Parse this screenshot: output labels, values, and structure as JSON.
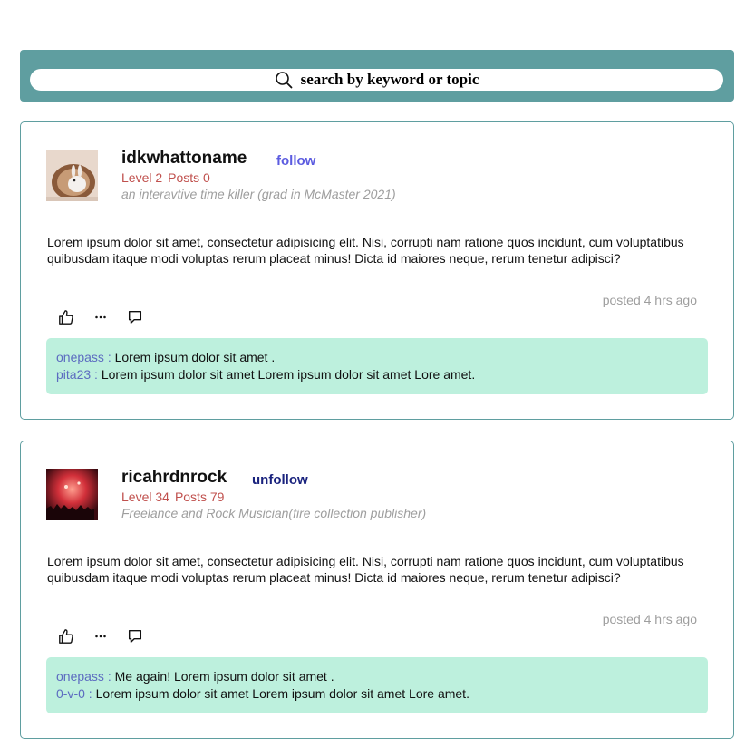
{
  "search": {
    "placeholder": "search by keyword or topic"
  },
  "posts": [
    {
      "username": "idkwhattoname",
      "follow_label": "follow",
      "follow_color": "#5c5ce0",
      "level": "Level 2",
      "posts": "Posts 0",
      "bio": "an interavtive time killer (grad in McMaster 2021)",
      "body": "Lorem ipsum dolor sit amet, consectetur adipisicing elit. Nisi, corrupti nam ratione quos incidunt, cum voluptatibus quibusdam itaque modi voluptas rerum placeat minus! Dicta id maiores neque, rerum tenetur adipisci?",
      "posted": "posted 4 hrs ago",
      "comments": [
        {
          "user": "onepass :",
          "text": " Lorem ipsum dolor sit amet ."
        },
        {
          "user": "pita23 :",
          "text": " Lorem ipsum dolor sit amet Lorem ipsum dolor sit amet Lore amet."
        }
      ]
    },
    {
      "username": "ricahrdnrock",
      "follow_label": "unfollow",
      "follow_color": "#1a237e",
      "level": "Level 34",
      "posts": "Posts 79",
      "bio": "Freelance and Rock Musician(fire collection publisher)",
      "body": "Lorem ipsum dolor sit amet, consectetur adipisicing elit. Nisi, corrupti nam ratione quos incidunt, cum voluptatibus quibusdam itaque modi voluptas rerum placeat minus! Dicta id maiores neque, rerum tenetur adipisci?",
      "posted": "posted 4 hrs ago",
      "comments": [
        {
          "user": "onepass :",
          "text": " Me again! Lorem ipsum dolor sit amet ."
        },
        {
          "user": "0-v-0 :",
          "text": " Lorem ipsum dolor sit amet Lorem ipsum dolor sit amet Lore amet."
        }
      ]
    }
  ],
  "icons": [
    "search-icon",
    "like-icon",
    "more-icon",
    "comment-icon"
  ]
}
